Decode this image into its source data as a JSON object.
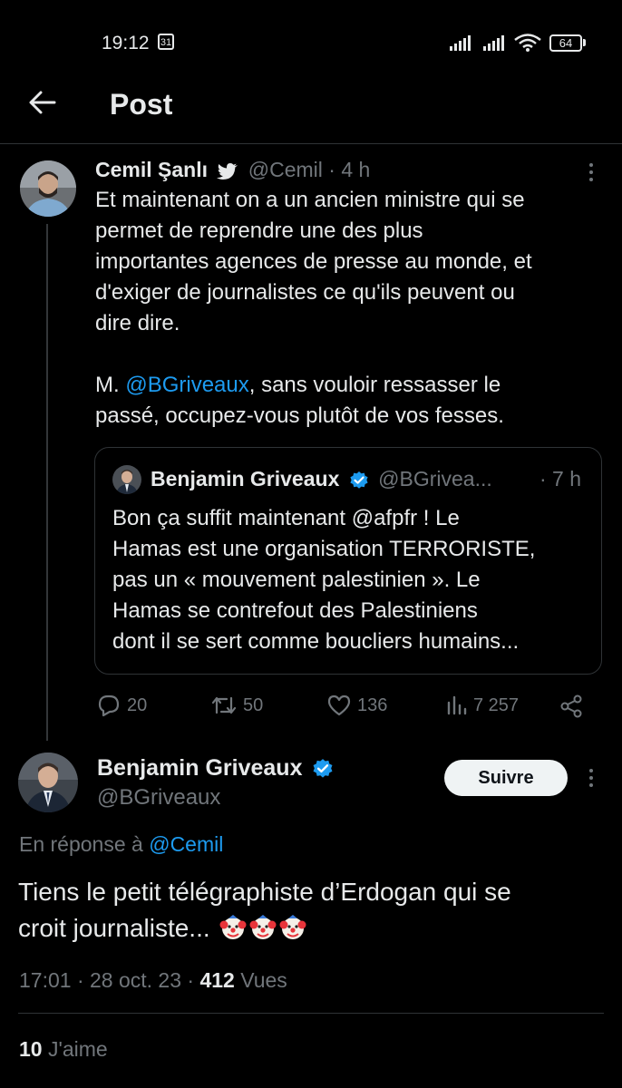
{
  "status_bar": {
    "time": "19:12",
    "calendar_day": "31",
    "battery": "64"
  },
  "header": {
    "title": "Post"
  },
  "parent_tweet": {
    "display_name": "Cemil Şanlı",
    "handle": "@Cemil",
    "age": "· 4 h",
    "text_lines": [
      "Et maintenant on a un ancien ministre qui se",
      "permet de reprendre une des plus",
      "importantes agences de presse au monde, et",
      "d'exiger de journalistes ce qu'ils peuvent ou",
      "dire dire."
    ],
    "text2_prefix": "M. ",
    "mention": "@BGriveaux",
    "text2_suffix": ", sans vouloir ressasser le",
    "text2_line2": "passé, occupez-vous plutôt de vos fesses.",
    "quote": {
      "display_name": "Benjamin Griveaux",
      "handle": "@BGrivea...",
      "age": "· 7 h",
      "lines": [
        "Bon ça suffit maintenant @afpfr ! Le",
        "Hamas est une organisation TERRORISTE,",
        "pas un « mouvement palestinien ». Le",
        "Hamas se contrefout des Palestiniens",
        "dont il se sert comme boucliers humains..."
      ]
    },
    "stats": {
      "replies": "20",
      "reposts": "50",
      "likes": "136",
      "views": "7 257"
    }
  },
  "main_tweet": {
    "display_name": "Benjamin Griveaux",
    "handle": "@BGriveaux",
    "follow_label": "Suivre",
    "reply_prefix": "En réponse à ",
    "reply_to": "@Cemil",
    "text_line1": "Tiens le petit télégraphiste d’Erdogan qui se",
    "text_line2": "croit journaliste...",
    "emojis": [
      "clown-emoji",
      "clown-emoji",
      "clown-emoji"
    ],
    "timestamp": "17:01 · 28 oct. 23 · ",
    "views_count": "412",
    "views_label": " Vues",
    "likes_count": "10",
    "likes_label": " J'aime"
  },
  "colors": {
    "background": "#000000",
    "text": "#e7e9ea",
    "muted": "#71767b",
    "link": "#1d9bf0",
    "verified": "#1d9bf0",
    "divider": "#2f3336"
  }
}
